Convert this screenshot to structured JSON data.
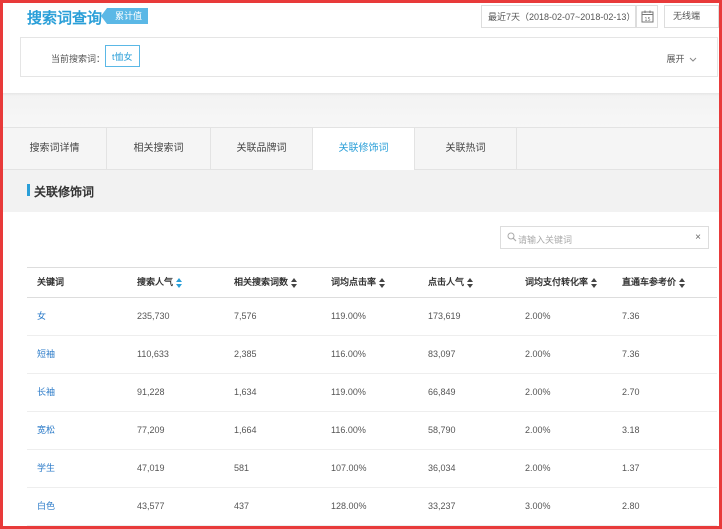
{
  "header": {
    "title": "搜索词查询",
    "badge": "累计值",
    "date_range": "最近7天（2018-02-07~2018-02-13）",
    "calendar_day": "15",
    "device": "无线端"
  },
  "term": {
    "label": "当前搜索词：",
    "value": "t恤女",
    "expand": "展开"
  },
  "tabs": [
    "搜索词详情",
    "相关搜索词",
    "关联品牌词",
    "关联修饰词",
    "关联热词"
  ],
  "active_tab": 3,
  "section": {
    "title": "关联修饰词"
  },
  "search": {
    "placeholder": "请输入关键词",
    "clear": "×"
  },
  "table": {
    "columns": [
      "关键词",
      "搜索人气",
      "相关搜索词数",
      "词均点击率",
      "点击人气",
      "词均支付转化率",
      "直通车参考价"
    ],
    "rows": [
      [
        "女",
        "235,730",
        "7,576",
        "119.00%",
        "173,619",
        "2.00%",
        "7.36"
      ],
      [
        "短袖",
        "110,633",
        "2,385",
        "116.00%",
        "83,097",
        "2.00%",
        "7.36"
      ],
      [
        "长袖",
        "91,228",
        "1,634",
        "119.00%",
        "66,849",
        "2.00%",
        "2.70"
      ],
      [
        "宽松",
        "77,209",
        "1,664",
        "116.00%",
        "58,790",
        "2.00%",
        "3.18"
      ],
      [
        "学生",
        "47,019",
        "581",
        "107.00%",
        "36,034",
        "2.00%",
        "1.37"
      ],
      [
        "白色",
        "43,577",
        "437",
        "128.00%",
        "33,237",
        "3.00%",
        "2.80"
      ]
    ]
  },
  "colors": {
    "accent": "#2a9fd8",
    "frame": "#e83a3a"
  }
}
